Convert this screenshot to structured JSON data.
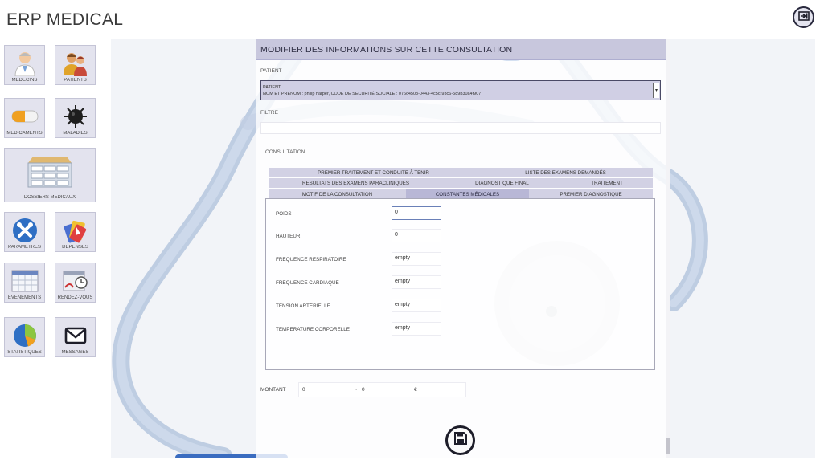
{
  "app": {
    "title": "ERP MEDICAL"
  },
  "header": {
    "exit_icon": "exit-icon"
  },
  "sidebar": {
    "tiles": [
      {
        "label": "MÉDECINS",
        "icon": "doctor-icon"
      },
      {
        "label": "PATIENTS",
        "icon": "patients-icon"
      },
      {
        "label": "MÉDICAMENTS",
        "icon": "pill-icon"
      },
      {
        "label": "MALADIES",
        "icon": "virus-icon"
      },
      {
        "label": "DOSSIERS MÉDICAUX",
        "icon": "files-icon"
      },
      {
        "label": "PARAMÈTRES",
        "icon": "tools-icon"
      },
      {
        "label": "DÉPENSES",
        "icon": "cards-icon"
      },
      {
        "label": "ÉVÉNEMENTS",
        "icon": "calendar-icon"
      },
      {
        "label": "RENDEZ-VOUS",
        "icon": "appointment-icon"
      },
      {
        "label": "STATISTIQUES",
        "icon": "pie-chart-icon"
      },
      {
        "label": "MESSAGES",
        "icon": "envelope-icon"
      }
    ]
  },
  "form": {
    "title": "MODIFIER DES INFORMATIONS SUR CETTE CONSULTATION",
    "patient_label": "PATIENT",
    "patient_select": {
      "line1": "PATIENT",
      "line2": "NOM ET PRÉNOM : philip harper, CODE DE SECURITÉ SOCIALE : 076c4503-0443-4c5c-93c6-589b30a4f907"
    },
    "filter_label": "FILTRE",
    "filter_value": "",
    "consultation_label": "CONSULTATION",
    "tabs": [
      "PREMIER TRAITEMENT ET CONDUITE À TENIR",
      "LISTE DES EXAMENS DEMANDÉS",
      "RESULTATS DES EXAMENS PARACLINIQUES",
      "DIAGNOSTIQUE FINAL",
      "TRAITEMENT",
      "MOTIF DE LA CONSULTATION",
      "CONSTANTES MÉDICALES",
      "PREMIER DIAGNOSTIQUE"
    ],
    "active_tab": "CONSTANTES MÉDICALES",
    "fields": [
      {
        "label": "POIDS",
        "value": "0"
      },
      {
        "label": "HAUTEUR",
        "value": "0"
      },
      {
        "label": "FREQUENCE RESPIRATOIRE",
        "value": "empty"
      },
      {
        "label": "FREQUENCE CARDIAQUE",
        "value": "empty"
      },
      {
        "label": "TENSION ARTÉRIELLE",
        "value": "empty"
      },
      {
        "label": "TEMPERATURE CORPORELLE",
        "value": "empty"
      }
    ],
    "montant_label": "MONTANT",
    "montant_value1": "0",
    "montant_sep": "·",
    "montant_value2": "0",
    "montant_currency": "€",
    "save_icon": "floppy-disk-icon"
  }
}
